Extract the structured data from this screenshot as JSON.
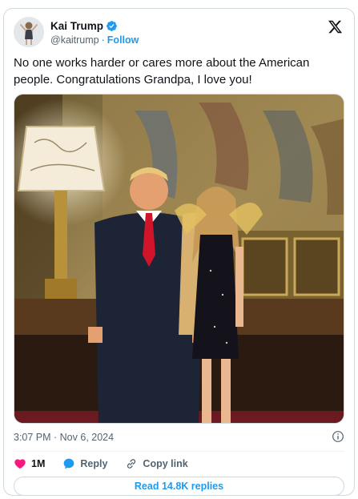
{
  "user": {
    "name": "Kai Trump",
    "handle": "@kaitrump",
    "separator": "·",
    "follow_label": "Follow",
    "verified_color": "#1d9bf0"
  },
  "tweet": {
    "text": "No one works harder or cares more about the American people. Congratulations Grandpa, I love you!",
    "timestamp": "3:07 PM · Nov 6, 2024"
  },
  "actions": {
    "like_count": "1M",
    "reply_label": "Reply",
    "copy_link_label": "Copy link"
  },
  "read_replies_label": "Read 14.8K replies",
  "colors": {
    "like": "#f91880",
    "reply": "#1d9bf0",
    "link": "#1d9bf0",
    "secondary_text": "#536471"
  },
  "icons": [
    "x-logo-icon",
    "verified-badge-icon",
    "info-icon",
    "heart-icon",
    "reply-bubble-icon",
    "link-icon"
  ]
}
